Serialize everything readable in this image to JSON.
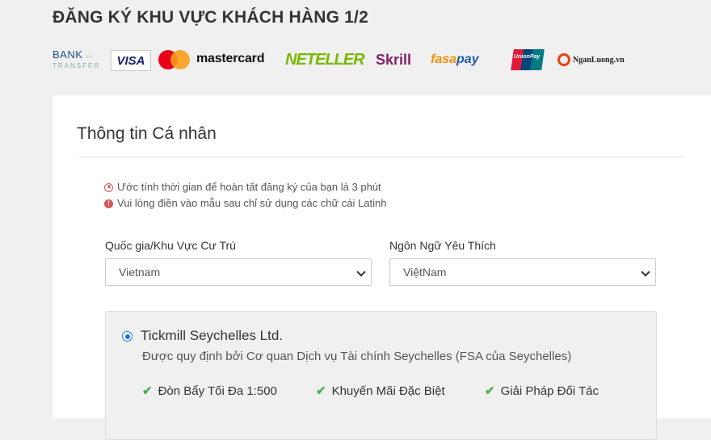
{
  "header": {
    "title": "ĐĂNG KÝ KHU VỰC KHÁCH HÀNG 1/2"
  },
  "payment_logos": {
    "bank_transfer": {
      "line1": "BANK",
      "line2": "TRANSFER"
    },
    "visa": "VISA",
    "mastercard": "mastercard",
    "neteller": "NETELLER",
    "skrill": "Skrill",
    "fasapay": {
      "part1": "fasa",
      "part2": "pay"
    },
    "unionpay": "UnionPay",
    "nganluong": "NganLuong.vn",
    "colors": {
      "visa": "#1a1f71",
      "mastercard_red": "#eb001b",
      "mastercard_orange": "#f79e1b",
      "neteller": "#7ab800",
      "skrill": "#862165",
      "fasapay": "#f39200"
    }
  },
  "form": {
    "section_title": "Thông tin Cá nhân",
    "notes": [
      {
        "icon": "clock-icon",
        "text": "Ước tính thời gian để hoàn tất đăng ký của bạn là 3 phút"
      },
      {
        "icon": "alert-icon",
        "text": "Vui lòng điền vào mẫu sau chỉ sử dụng các chữ cái Latinh"
      }
    ],
    "country": {
      "label": "Quốc gia/Khu Vực Cư Trú",
      "value": "Vietnam"
    },
    "language": {
      "label": "Ngôn Ngữ Yêu Thích",
      "value": "ViệtNam"
    },
    "entity": {
      "selected": true,
      "name": "Tickmill Seychelles Ltd.",
      "regulation": "Được quy định bởi Cơ quan Dịch vụ Tài chính Seychelles (FSA của Seychelles)",
      "features": [
        "Đòn Bẩy Tối Đa 1:500",
        "Khuyến Mãi Đặc Biệt",
        "Giải Pháp Đối Tác"
      ]
    }
  },
  "colors": {
    "accent": "#1a73e8",
    "alert": "#d9534f",
    "check": "#4caf50"
  }
}
